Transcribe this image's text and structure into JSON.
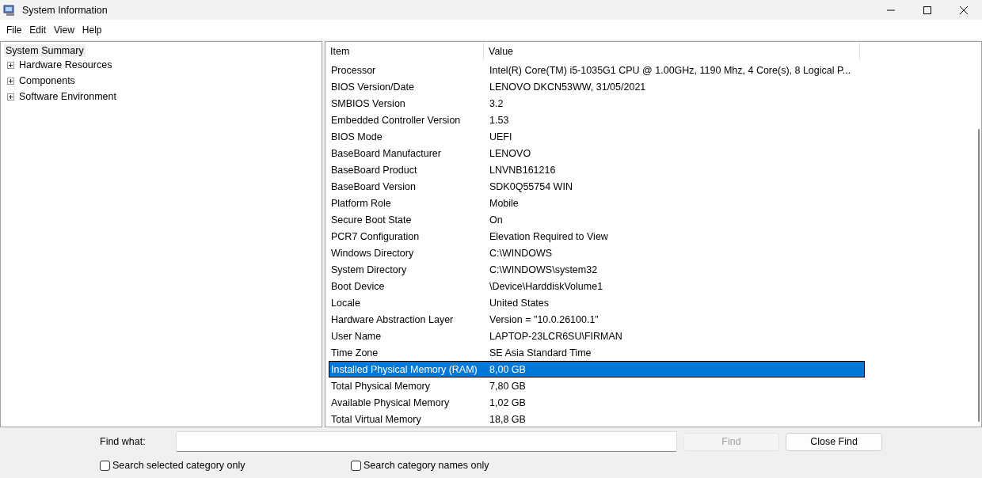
{
  "window": {
    "title": "System Information"
  },
  "menu": [
    "File",
    "Edit",
    "View",
    "Help"
  ],
  "tree": {
    "label": "System Summary",
    "selected": true,
    "children": [
      {
        "label": "Hardware Resources",
        "expanded": false,
        "selected": false
      },
      {
        "label": "Components",
        "expanded": false,
        "selected": false
      },
      {
        "label": "Software Environment",
        "expanded": false,
        "selected": false
      }
    ]
  },
  "table": {
    "columns": [
      "Item",
      "Value"
    ],
    "rows": [
      {
        "item": "Processor",
        "value": "Intel(R) Core(TM) i5-1035G1 CPU @ 1.00GHz, 1190 Mhz, 4 Core(s), 8 Logical P...",
        "selected": false
      },
      {
        "item": "BIOS Version/Date",
        "value": "LENOVO DKCN53WW, 31/05/2021",
        "selected": false
      },
      {
        "item": "SMBIOS Version",
        "value": "3.2",
        "selected": false
      },
      {
        "item": "Embedded Controller Version",
        "value": "1.53",
        "selected": false
      },
      {
        "item": "BIOS Mode",
        "value": "UEFI",
        "selected": false
      },
      {
        "item": "BaseBoard Manufacturer",
        "value": "LENOVO",
        "selected": false
      },
      {
        "item": "BaseBoard Product",
        "value": "LNVNB161216",
        "selected": false
      },
      {
        "item": "BaseBoard Version",
        "value": "SDK0Q55754 WIN",
        "selected": false
      },
      {
        "item": "Platform Role",
        "value": "Mobile",
        "selected": false
      },
      {
        "item": "Secure Boot State",
        "value": "On",
        "selected": false
      },
      {
        "item": "PCR7 Configuration",
        "value": "Elevation Required to View",
        "selected": false
      },
      {
        "item": "Windows Directory",
        "value": "C:\\WINDOWS",
        "selected": false
      },
      {
        "item": "System Directory",
        "value": "C:\\WINDOWS\\system32",
        "selected": false
      },
      {
        "item": "Boot Device",
        "value": "\\Device\\HarddiskVolume1",
        "selected": false
      },
      {
        "item": "Locale",
        "value": "United States",
        "selected": false
      },
      {
        "item": "Hardware Abstraction Layer",
        "value": "Version = \"10.0.26100.1\"",
        "selected": false
      },
      {
        "item": "User Name",
        "value": "LAPTOP-23LCR6SU\\FIRMAN",
        "selected": false
      },
      {
        "item": "Time Zone",
        "value": "SE Asia Standard Time",
        "selected": false
      },
      {
        "item": "Installed Physical Memory (RAM)",
        "value": "8,00 GB",
        "selected": true
      },
      {
        "item": "Total Physical Memory",
        "value": "7,80 GB",
        "selected": false
      },
      {
        "item": "Available Physical Memory",
        "value": "1,02 GB",
        "selected": false
      },
      {
        "item": "Total Virtual Memory",
        "value": "18,8 GB",
        "selected": false
      }
    ]
  },
  "find": {
    "label": "Find what:",
    "find_button": {
      "label": "Find",
      "disabled": true
    },
    "close_button": "Close Find",
    "options": [
      {
        "label": "Search selected category only",
        "checked": false
      },
      {
        "label": "Search category names only",
        "checked": false
      }
    ]
  }
}
